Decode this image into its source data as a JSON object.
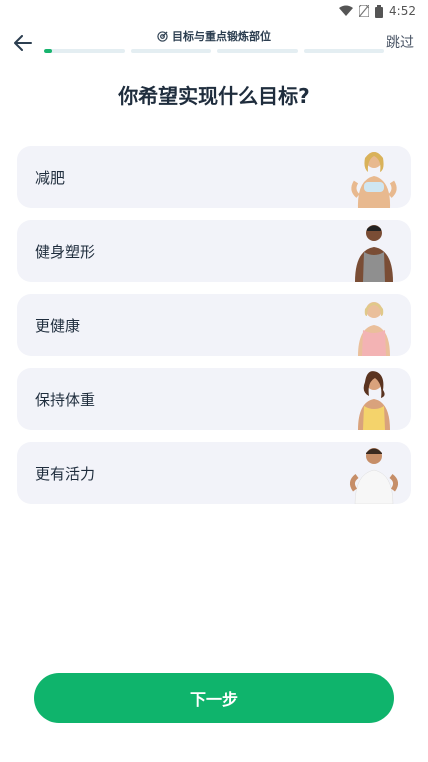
{
  "status_bar": {
    "time": "4:52"
  },
  "header": {
    "step_title": "目标与重点锻炼部位",
    "skip_label": "跳过",
    "progress_step": 1,
    "progress_total": 4,
    "progress_fraction_of_current_segment": 0.1,
    "accent_color": "#18b46e"
  },
  "question": "你希望实现什么目标?",
  "options": [
    {
      "label": "减肥",
      "icon": "woman-athletic-avatar"
    },
    {
      "label": "健身塑形",
      "icon": "man-muscular-avatar"
    },
    {
      "label": "更健康",
      "icon": "older-woman-avatar"
    },
    {
      "label": "保持体重",
      "icon": "woman-yellow-top-avatar"
    },
    {
      "label": "更有活力",
      "icon": "man-white-tee-avatar"
    }
  ],
  "next_button": {
    "label": "下一步",
    "color": "#0fb46c"
  }
}
